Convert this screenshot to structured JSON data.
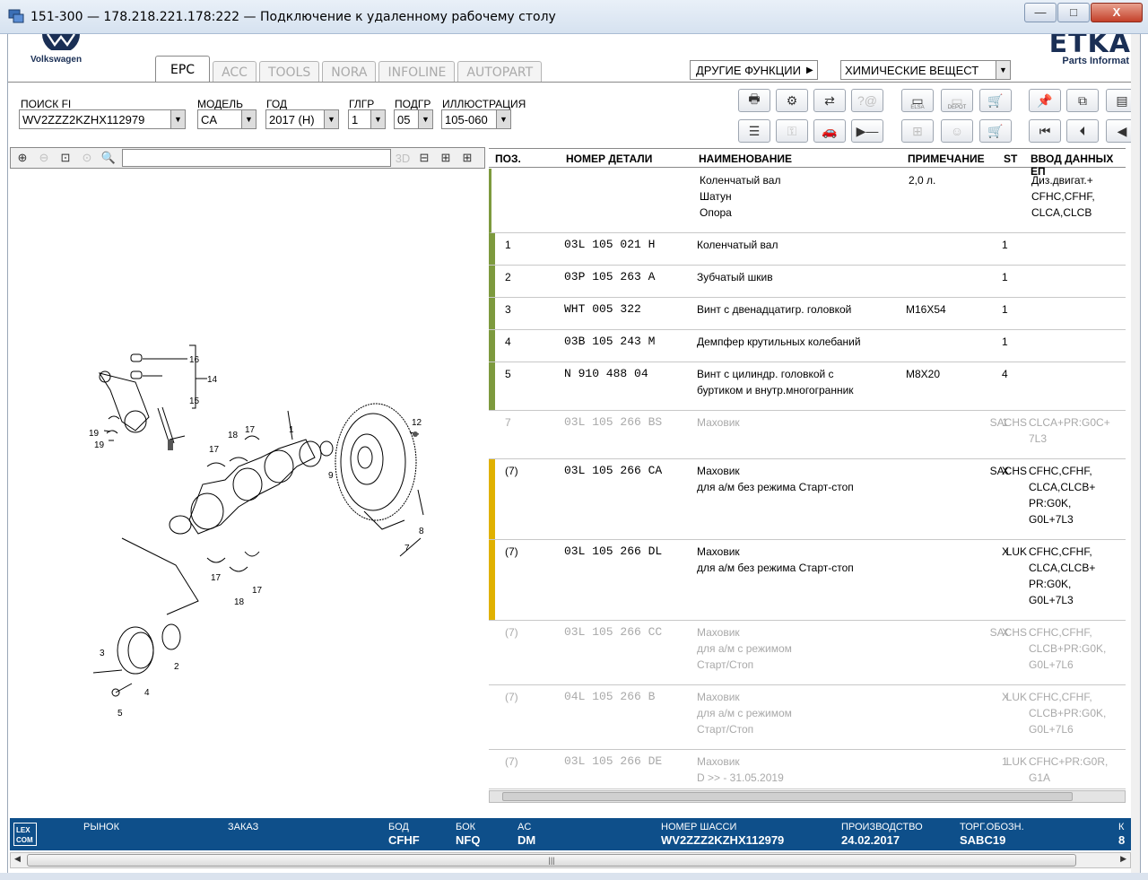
{
  "window": {
    "title": "151-300 — 178.218.221.178:222 — Подключение к удаленному рабочему столу",
    "minimize": "—",
    "maximize": "□",
    "close": "X"
  },
  "header": {
    "brand": "Volkswagen",
    "logo_text": "ETKA",
    "logo_sub": "Parts Informat",
    "tabs": [
      "EPC",
      "ACC",
      "TOOLS",
      "NORA",
      "INFOLINE",
      "AUTOPART"
    ],
    "active_tab": "EPC",
    "other_functions": "ДРУГИЕ ФУНКЦИИ",
    "chem_select": "ХИМИЧЕСКИЕ ВЕЩЕСТ"
  },
  "search": {
    "fi_label": "ПОИСК FI",
    "fi_value": "WV2ZZZ2KZHX112979",
    "model_label": "МОДЕЛЬ",
    "model_value": "CA",
    "year_label": "ГОД",
    "year_value": "2017 (H)",
    "mg_label": "ГЛГР",
    "mg_value": "1",
    "sg_label": "ПОДГР",
    "sg_value": "05",
    "ill_label": "ИЛЛЮСТРАЦИЯ",
    "ill_value": "105-060"
  },
  "toolbar": {
    "elsa": "ELSA",
    "depot": "DEPOT"
  },
  "illustration_toolbar": {
    "three_d": "3D"
  },
  "illustration": {
    "callouts": [
      "16",
      "14",
      "15",
      "19",
      "19",
      "17",
      "18",
      "17",
      "1",
      "17",
      "18",
      "17",
      "9",
      "12",
      "8",
      "7",
      "2",
      "3",
      "4",
      "5"
    ]
  },
  "table": {
    "headers": {
      "pos": "ПОЗ.",
      "number": "НОМЕР ДЕТАЛИ",
      "name": "НАИМЕНОВАНИЕ",
      "note": "ПРИМЕЧАНИЕ",
      "st": "ST",
      "input": "ВВОД ДАННЫХ ЕП"
    },
    "group": {
      "name": "Коленчатый вал\nШатун\nОпора",
      "note": "2,0 л.",
      "input": "Диз.двигат.+\nCFHC,CFHF,\nCLCA,CLCB"
    },
    "rows": [
      {
        "pos": "1",
        "number": "03L  105  021  H",
        "name": "Коленчатый вал",
        "note": "",
        "supplier": "",
        "st": "1",
        "input": "",
        "state": "active",
        "bar": "#7d9a3e"
      },
      {
        "pos": "2",
        "number": "03P  105  263  A",
        "name": "Зубчатый шкив",
        "note": "",
        "supplier": "",
        "st": "1",
        "input": "",
        "state": "active",
        "bar": "#7d9a3e"
      },
      {
        "pos": "3",
        "number": "WHT  005  322",
        "name": "Винт с двенадцатигр. головкой",
        "note": "M16X54",
        "supplier": "",
        "st": "1",
        "input": "",
        "state": "active",
        "bar": "#7d9a3e"
      },
      {
        "pos": "4",
        "number": "03B  105  243  M",
        "name": "Демпфер крутильных колебаний",
        "note": "",
        "supplier": "",
        "st": "1",
        "input": "",
        "state": "active",
        "bar": "#7d9a3e"
      },
      {
        "pos": "5",
        "number": "N    910  488  04",
        "name": "Винт с цилиндр. головкой с\nбуртиком и внутр.многогранник",
        "note": "M8X20",
        "supplier": "",
        "st": "4",
        "input": "",
        "state": "active",
        "bar": "#7d9a3e"
      },
      {
        "pos": "7",
        "number": "03L  105  266  BS",
        "name": "Маховик",
        "note": "",
        "supplier": "SACHS",
        "st": "1",
        "input": "CLCA+PR:G0C+\n7L3",
        "state": "grey",
        "bar": ""
      },
      {
        "pos": "(7)",
        "number": "03L  105  266  CA",
        "name": "Маховик\nдля а/м без режима Старт-стоп",
        "note": "",
        "supplier": "SACHS",
        "st": "X",
        "input": "CFHC,CFHF,\nCLCA,CLCB+\nPR:G0K,\nG0L+7L3",
        "state": "active",
        "bar": "#e0b100"
      },
      {
        "pos": "(7)",
        "number": "03L  105  266  DL",
        "name": "Маховик\nдля а/м без режима Старт-стоп",
        "note": "",
        "supplier": "LUK",
        "st": "X",
        "input": "CFHC,CFHF,\nCLCA,CLCB+\nPR:G0K,\nG0L+7L3",
        "state": "active",
        "bar": "#e0b100"
      },
      {
        "pos": "(7)",
        "number": "03L  105  266  CC",
        "name": "Маховик\nдля а/м с режимом\nСтарт/Стоп",
        "note": "",
        "supplier": "SACHS",
        "st": "X",
        "input": "CFHC,CFHF,\nCLCB+PR:G0K,\nG0L+7L6",
        "state": "grey",
        "bar": ""
      },
      {
        "pos": "(7)",
        "number": "04L  105  266  B",
        "name": "Маховик\nдля а/м с режимом\nСтарт/Стоп",
        "note": "",
        "supplier": "LUK",
        "st": "X",
        "input": "CFHC,CFHF,\nCLCB+PR:G0K,\nG0L+7L6",
        "state": "grey",
        "bar": ""
      },
      {
        "pos": "(7)",
        "number": "03L  105  266  DE",
        "name": "Маховик\nD            >> - 31.05.2019",
        "note": "",
        "supplier": "LUK",
        "st": "1",
        "input": "CFHC+PR:G0R,\nG1A",
        "state": "grey",
        "bar": ""
      }
    ]
  },
  "status": {
    "logo": "LEX\nCOM",
    "market_label": "РЫНОК",
    "order_label": "ЗАКАЗ",
    "bod_label": "БОД",
    "bod_value": "CFHF",
    "bok_label": "БОК",
    "bok_value": "NFQ",
    "ac_label": "AC",
    "ac_value": "DM",
    "vin_label": "НОМЕР ШАССИ",
    "vin_value": "WV2ZZZ2KZHX112979",
    "prod_label": "ПРОИЗВОДСТВО",
    "prod_value": "24.02.2017",
    "trade_label": "ТОРГ.ОБОЗН.",
    "trade_value": "SABC19",
    "k_label": "К",
    "k_value": "8"
  },
  "colors": {
    "status_bg": "#0e4f8a",
    "bar_green": "#7d9a3e",
    "bar_yellow": "#e0b100",
    "muted_text": "#a9a9a9"
  }
}
